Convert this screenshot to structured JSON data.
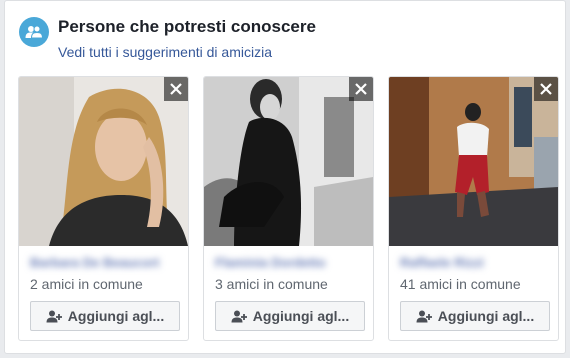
{
  "header": {
    "title": "Persone che potresti conoscere",
    "link": "Vedi tutti i suggerimenti di amicizia",
    "icon": "people-icon"
  },
  "cards": [
    {
      "name": "Barbara De Beaucort",
      "mutual": "2 amici in comune",
      "button_label": "Aggiungi agl...",
      "close_icon": "close-icon"
    },
    {
      "name": "Flaminia Dordetto",
      "mutual": "3 amici in comune",
      "button_label": "Aggiungi agl...",
      "close_icon": "close-icon"
    },
    {
      "name": "Raffaele Rizzi",
      "mutual": "41 amici in comune",
      "button_label": "Aggiungi agl...",
      "close_icon": "close-icon"
    }
  ],
  "colors": {
    "link": "#365899",
    "icon_bg": "#4aa8d8",
    "text_dark": "#1d2129",
    "text_muted": "#606770"
  }
}
